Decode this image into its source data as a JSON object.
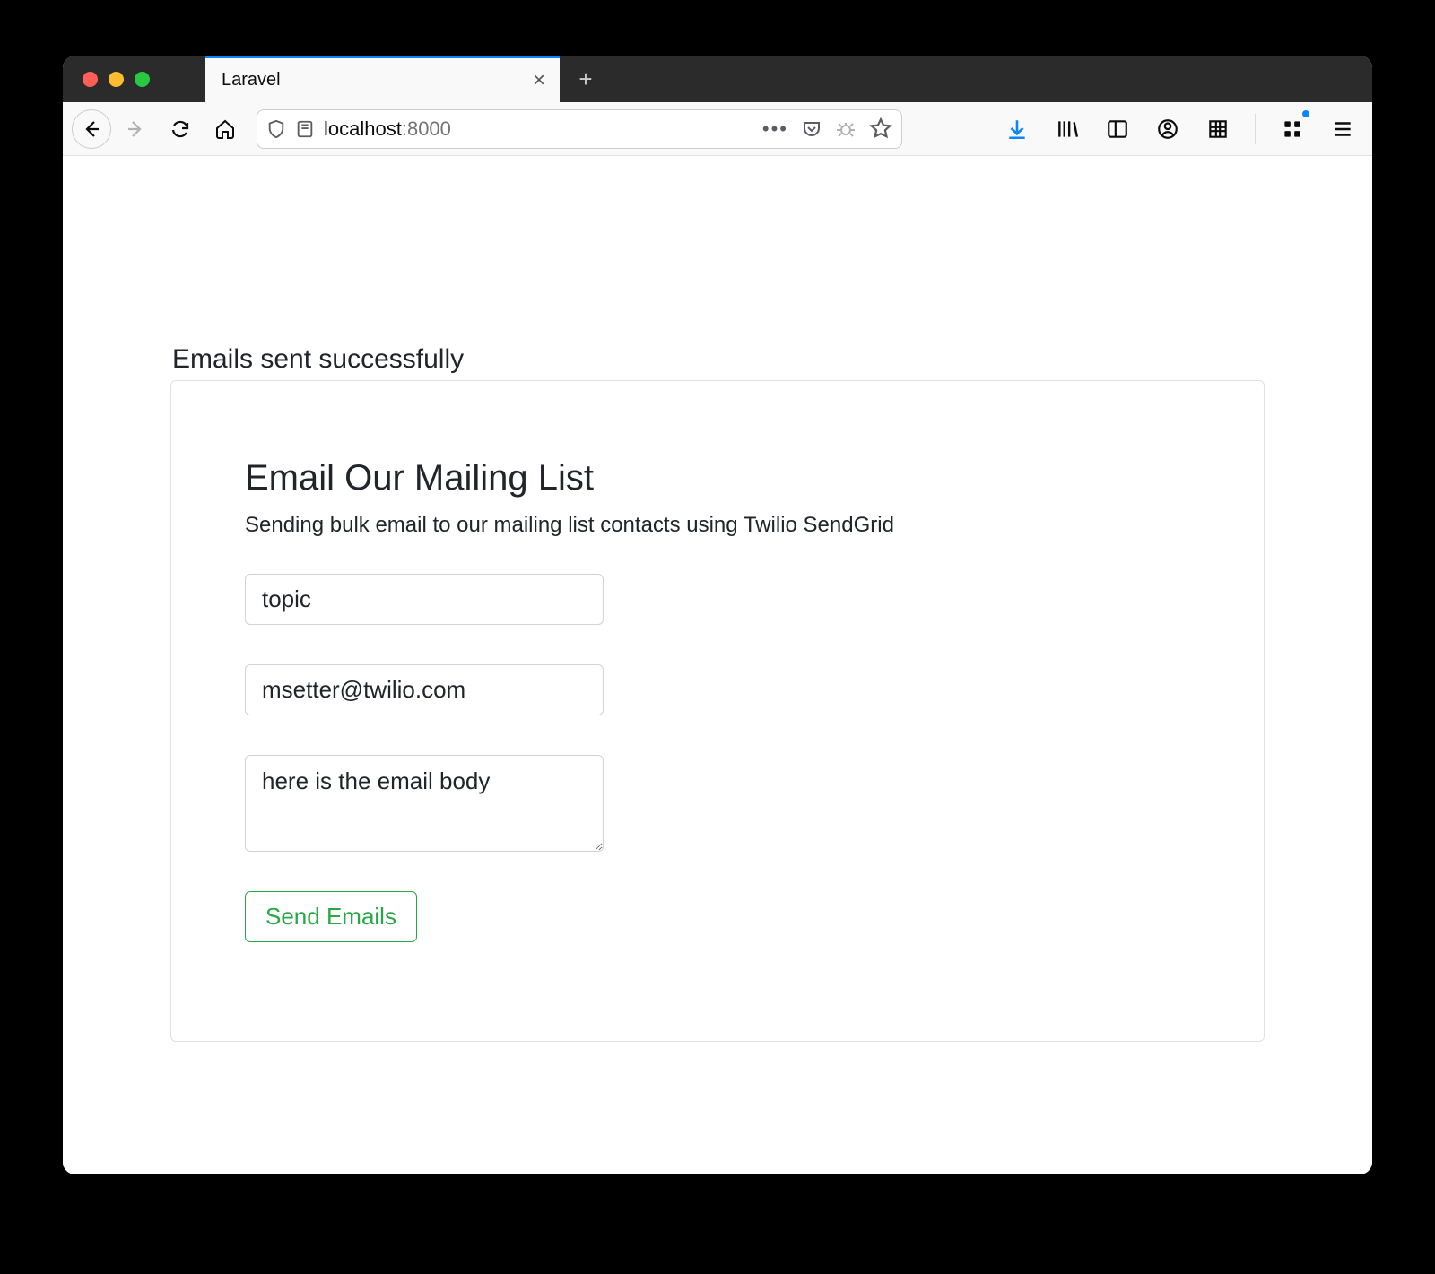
{
  "browser": {
    "tab_title": "Laravel",
    "url_host": "localhost",
    "url_port": ":8000"
  },
  "page": {
    "status_message": "Emails sent successfully",
    "heading": "Email Our Mailing List",
    "subheading": "Sending bulk email to our mailing list contacts using Twilio SendGrid",
    "form": {
      "topic_value": "topic",
      "from_value": "msetter@twilio.com",
      "body_value": "here is the email body",
      "submit_label": "Send Emails"
    }
  }
}
